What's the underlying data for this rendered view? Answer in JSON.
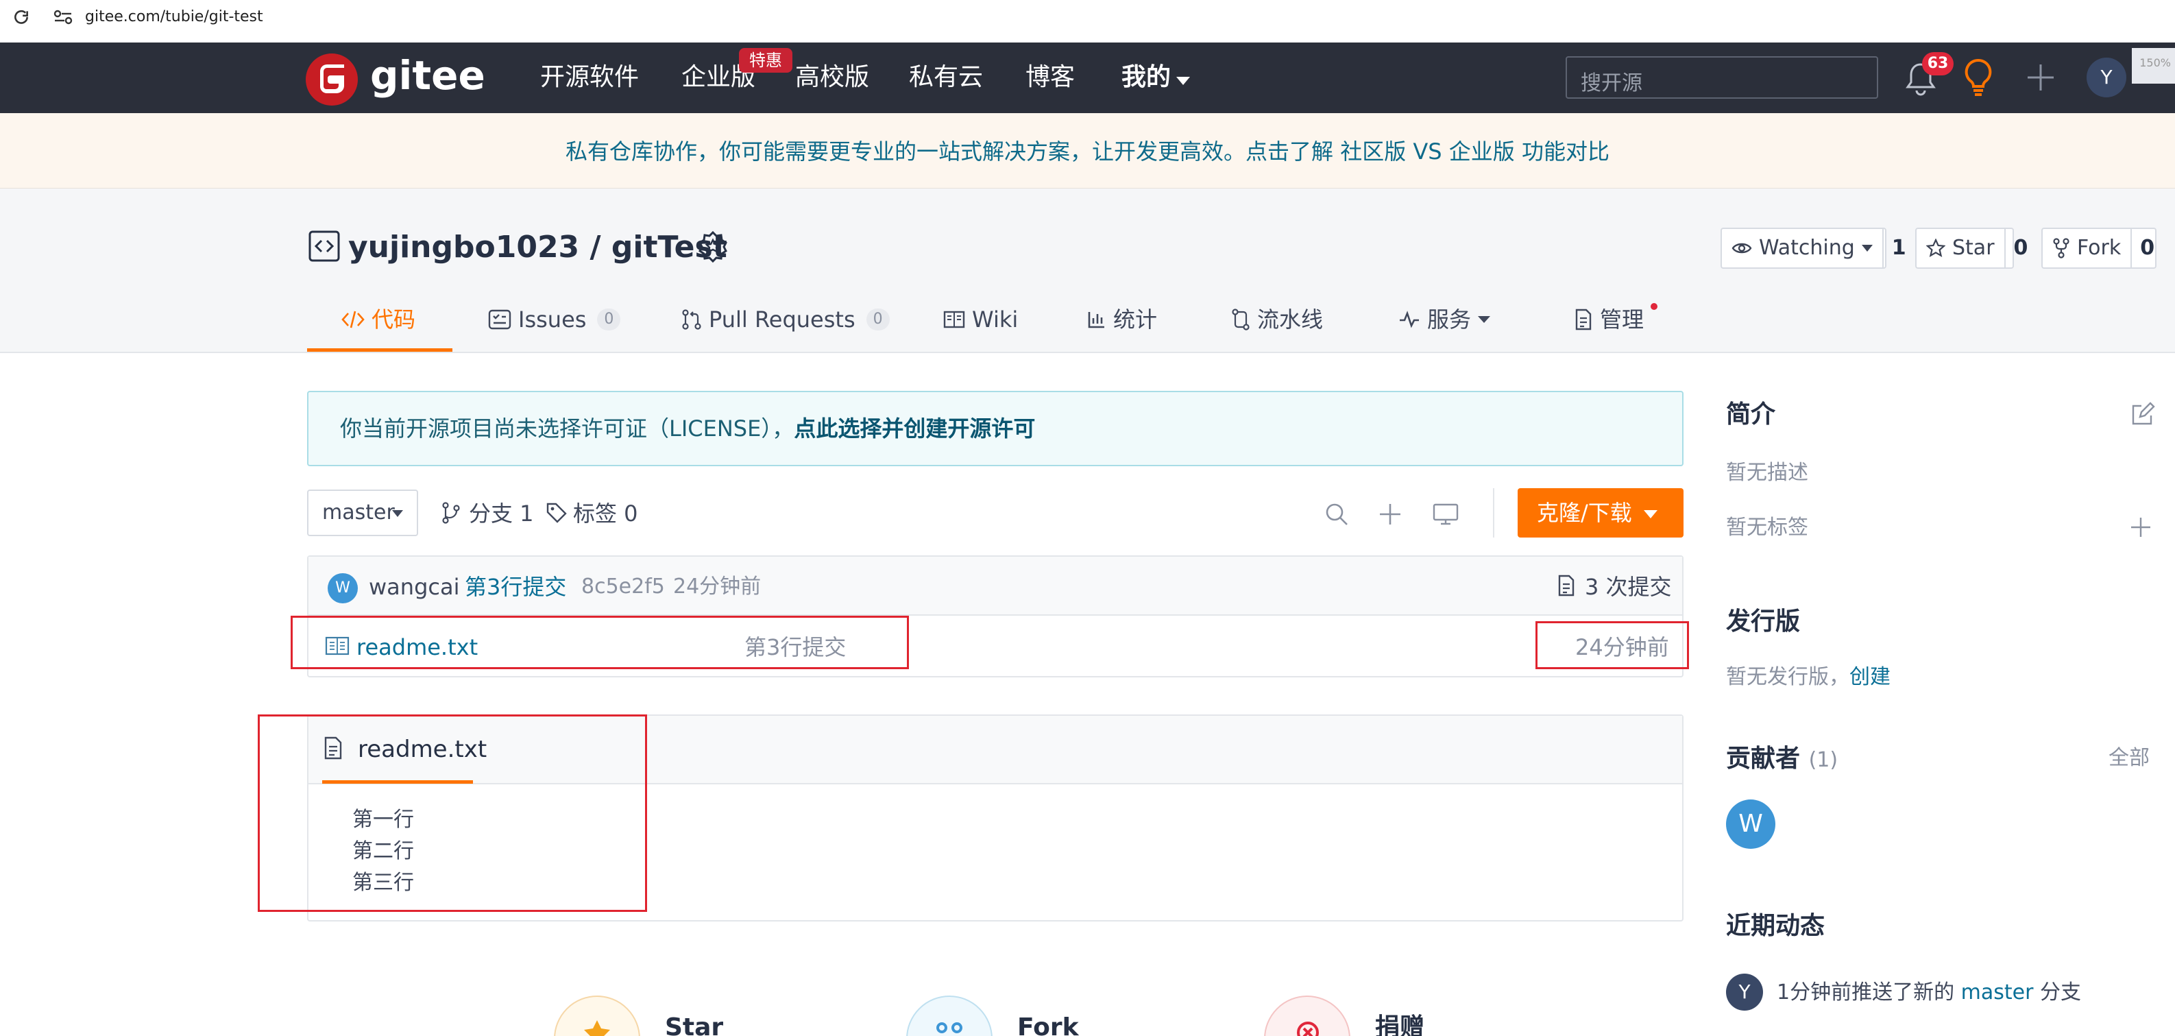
{
  "browser": {
    "url": "gitee.com/tubie/git-test"
  },
  "nav": {
    "logo_text": "gitee",
    "links": [
      "开源软件",
      "企业版",
      "高校版",
      "私有云",
      "博客",
      "我的"
    ],
    "badge": "特惠",
    "search_placeholder": "搜开源",
    "notification_count": "63",
    "avatar_letter": "Y",
    "zoom": "150%"
  },
  "banner": {
    "text": "私有仓库协作，你可能需要更专业的一站式解决方案，让开发更高效。点击了解 社区版 VS 企业版 功能对比"
  },
  "repo": {
    "title": "yujingbo1023 / gitTest",
    "watching_label": "Watching",
    "watching_count": "1",
    "star_label": "Star",
    "star_count": "0",
    "fork_label": "Fork",
    "fork_count": "0"
  },
  "tabs": {
    "code": "代码",
    "issues": "Issues",
    "issues_count": "0",
    "pulls": "Pull Requests",
    "pulls_count": "0",
    "wiki": "Wiki",
    "stats": "统计",
    "pipeline": "流水线",
    "services": "服务",
    "manage": "管理"
  },
  "license": {
    "text": "你当前开源项目尚未选择许可证（LICENSE），",
    "link": "点此选择并创建开源许可"
  },
  "branch": {
    "name": "master",
    "branches": "分支 1",
    "tags": "标签 0",
    "clone": "克隆/下载"
  },
  "commit": {
    "avatar": "W",
    "author": "wangcai",
    "message": "第3行提交",
    "hash": "8c5e2f5",
    "time": "24分钟前",
    "count": "3 次提交"
  },
  "files": [
    {
      "name": "readme.txt",
      "message": "第3行提交",
      "time": "24分钟前"
    }
  ],
  "readme": {
    "title": "readme.txt",
    "lines": [
      "第一行",
      "第二行",
      "第三行"
    ]
  },
  "sidebar": {
    "intro_title": "简介",
    "no_desc": "暂无描述",
    "no_tags": "暂无标签",
    "release_title": "发行版",
    "no_release": "暂无发行版，",
    "create": "创建",
    "contrib_title": "贡献者",
    "contrib_count": "(1)",
    "all": "全部",
    "contrib_avatar": "W",
    "activity_title": "近期动态",
    "activity_avatar": "Y",
    "activity_text_a": "1分钟前推送了新的 ",
    "activity_branch": "master",
    "activity_text_b": " 分支"
  },
  "bottom": {
    "star": "Star",
    "fork": "Fork",
    "donate": "捐赠"
  },
  "colors": {
    "nav_bg": "#2b2f3a",
    "accent": "#fe7300",
    "link": "#0a6f96",
    "highlight": "#e0242f"
  }
}
